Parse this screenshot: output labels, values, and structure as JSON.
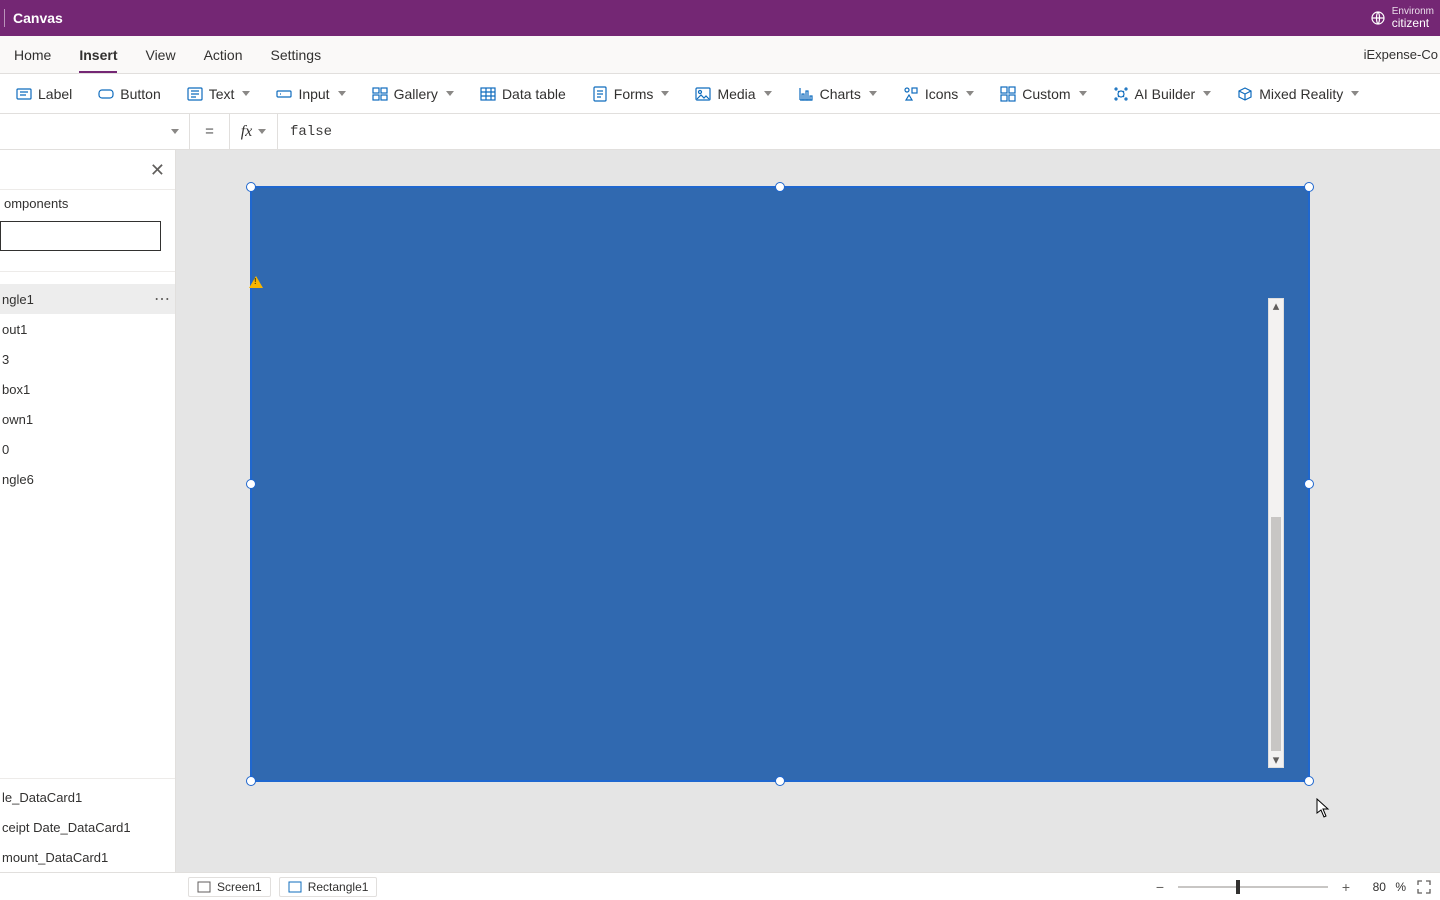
{
  "topbar": {
    "title": "Canvas",
    "env_label": "Environm",
    "env_name": "citizent"
  },
  "menubar": {
    "tabs": [
      {
        "label": "Home",
        "active": false
      },
      {
        "label": "Insert",
        "active": true
      },
      {
        "label": "View",
        "active": false
      },
      {
        "label": "Action",
        "active": false
      },
      {
        "label": "Settings",
        "active": false
      }
    ],
    "app_name": "iExpense-Co"
  },
  "ribbon": {
    "buttons": [
      {
        "label": "Label",
        "icon": "label-icon",
        "dropdown": false
      },
      {
        "label": "Button",
        "icon": "button-icon",
        "dropdown": false
      },
      {
        "label": "Text",
        "icon": "text-icon",
        "dropdown": true
      },
      {
        "label": "Input",
        "icon": "input-icon",
        "dropdown": true
      },
      {
        "label": "Gallery",
        "icon": "gallery-icon",
        "dropdown": true
      },
      {
        "label": "Data table",
        "icon": "datatable-icon",
        "dropdown": false
      },
      {
        "label": "Forms",
        "icon": "forms-icon",
        "dropdown": true
      },
      {
        "label": "Media",
        "icon": "media-icon",
        "dropdown": true
      },
      {
        "label": "Charts",
        "icon": "charts-icon",
        "dropdown": true
      },
      {
        "label": "Icons",
        "icon": "icons-icon",
        "dropdown": true
      },
      {
        "label": "Custom",
        "icon": "custom-icon",
        "dropdown": true
      },
      {
        "label": "AI Builder",
        "icon": "aibuilder-icon",
        "dropdown": true
      },
      {
        "label": "Mixed Reality",
        "icon": "mixedreality-icon",
        "dropdown": true
      }
    ]
  },
  "formula": {
    "equals": "=",
    "fx": "fx",
    "value": "false"
  },
  "tree": {
    "section_title": "omponents",
    "items": [
      "ngle1",
      "out1",
      "3",
      "box1",
      "own1",
      "0",
      "ngle6"
    ],
    "selected_index": 0,
    "children": [
      "le_DataCard1",
      "ceipt Date_DataCard1",
      "mount_DataCard1"
    ]
  },
  "status": {
    "breadcrumb_screen": "Screen1",
    "breadcrumb_selected": "Rectangle1",
    "zoom_value": "80",
    "zoom_unit": "%"
  }
}
